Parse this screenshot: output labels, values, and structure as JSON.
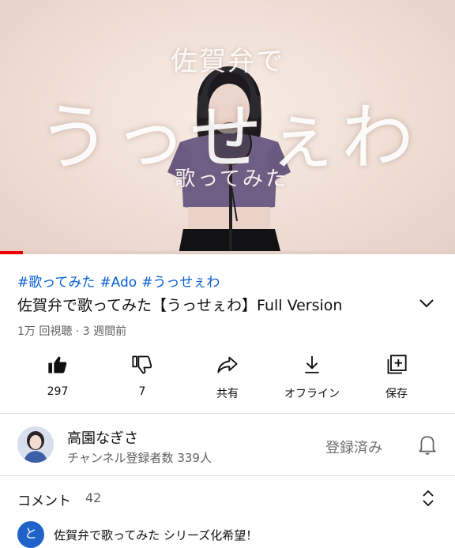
{
  "video": {
    "overlay_top": "佐賀弁で",
    "overlay_title": "うっせぇわ",
    "overlay_sub": "歌ってみた",
    "progress_fraction": 0.05
  },
  "info": {
    "hashtags": [
      "#歌ってみた",
      "#Ado",
      "#うっせぇわ"
    ],
    "title": "佐賀弁で歌ってみた【うっせぇわ】Full Version",
    "meta": "1万 回視聴 · 3 週間前"
  },
  "actions": {
    "like": "297",
    "dislike": "7",
    "share": "共有",
    "offline": "オフライン",
    "save": "保存"
  },
  "channel": {
    "name": "高園なぎさ",
    "subscribers": "チャンネル登録者数 339人",
    "subscribed_label": "登録済み"
  },
  "comments": {
    "label": "コメント",
    "count": "42",
    "first_avatar_letter": "と",
    "first_text": "佐賀弁で歌ってみた シリーズ化希望！"
  },
  "colors": {
    "link": "#065fd4",
    "progress": "#ee0000",
    "comment_avatar": "#1f62c9"
  }
}
